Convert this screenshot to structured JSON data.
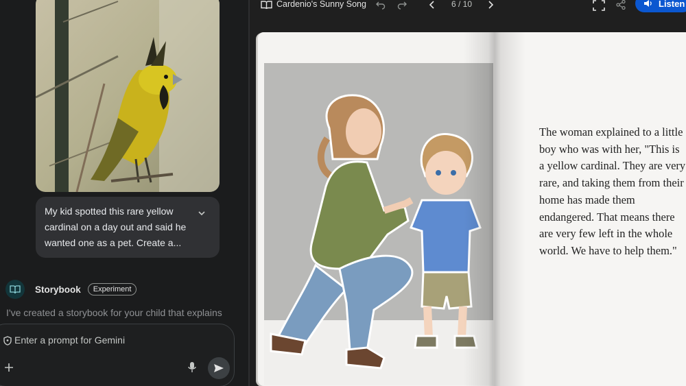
{
  "chat": {
    "user_message": "My kid spotted this rare yellow cardinal on a day out and said he wanted one as a pet. Create a...",
    "model_name": "Storybook",
    "model_badge": "Experiment",
    "response_preview": "I've created a storybook for your child that explains",
    "prompt_placeholder": "Enter a prompt for Gemini"
  },
  "viewer": {
    "title": "Cardenio's Sunny Song",
    "page_indicator": "6 / 10",
    "listen_label": "Listen",
    "page_text": "The woman explained to a little boy who was with her, \"This is a yellow cardinal. They are very rare, and taking them from their home has made them endangered. That means there are very few left in the whole world. We have to help them.\""
  },
  "colors": {
    "listen_button": "#0b57d0",
    "panel_bg": "#1b1c1d",
    "viewer_bg": "#1f1f1f",
    "bubble_bg": "#303134",
    "page_bg": "#f4f3f1"
  },
  "icons": [
    "book-icon",
    "undo-icon",
    "redo-icon",
    "chevron-left-icon",
    "chevron-right-icon",
    "fullscreen-icon",
    "share-icon",
    "speaker-icon",
    "chevron-down-icon",
    "shield-icon",
    "plus-icon",
    "mic-icon",
    "send-icon",
    "storybook-icon"
  ]
}
